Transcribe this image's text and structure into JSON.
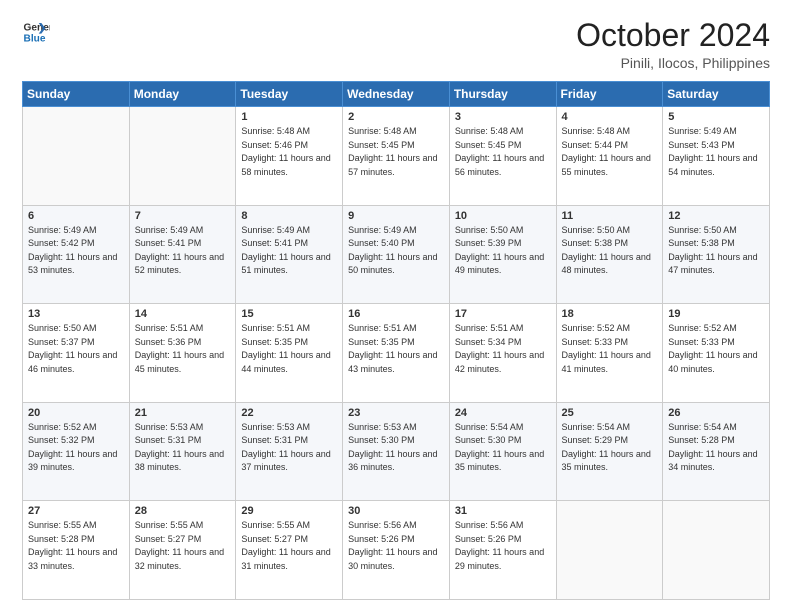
{
  "header": {
    "logo_line1": "General",
    "logo_line2": "Blue",
    "month": "October 2024",
    "location": "Pinili, Ilocos, Philippines"
  },
  "weekdays": [
    "Sunday",
    "Monday",
    "Tuesday",
    "Wednesday",
    "Thursday",
    "Friday",
    "Saturday"
  ],
  "weeks": [
    [
      {
        "day": "",
        "sunrise": "",
        "sunset": "",
        "daylight": ""
      },
      {
        "day": "",
        "sunrise": "",
        "sunset": "",
        "daylight": ""
      },
      {
        "day": "1",
        "sunrise": "Sunrise: 5:48 AM",
        "sunset": "Sunset: 5:46 PM",
        "daylight": "Daylight: 11 hours and 58 minutes."
      },
      {
        "day": "2",
        "sunrise": "Sunrise: 5:48 AM",
        "sunset": "Sunset: 5:45 PM",
        "daylight": "Daylight: 11 hours and 57 minutes."
      },
      {
        "day": "3",
        "sunrise": "Sunrise: 5:48 AM",
        "sunset": "Sunset: 5:45 PM",
        "daylight": "Daylight: 11 hours and 56 minutes."
      },
      {
        "day": "4",
        "sunrise": "Sunrise: 5:48 AM",
        "sunset": "Sunset: 5:44 PM",
        "daylight": "Daylight: 11 hours and 55 minutes."
      },
      {
        "day": "5",
        "sunrise": "Sunrise: 5:49 AM",
        "sunset": "Sunset: 5:43 PM",
        "daylight": "Daylight: 11 hours and 54 minutes."
      }
    ],
    [
      {
        "day": "6",
        "sunrise": "Sunrise: 5:49 AM",
        "sunset": "Sunset: 5:42 PM",
        "daylight": "Daylight: 11 hours and 53 minutes."
      },
      {
        "day": "7",
        "sunrise": "Sunrise: 5:49 AM",
        "sunset": "Sunset: 5:41 PM",
        "daylight": "Daylight: 11 hours and 52 minutes."
      },
      {
        "day": "8",
        "sunrise": "Sunrise: 5:49 AM",
        "sunset": "Sunset: 5:41 PM",
        "daylight": "Daylight: 11 hours and 51 minutes."
      },
      {
        "day": "9",
        "sunrise": "Sunrise: 5:49 AM",
        "sunset": "Sunset: 5:40 PM",
        "daylight": "Daylight: 11 hours and 50 minutes."
      },
      {
        "day": "10",
        "sunrise": "Sunrise: 5:50 AM",
        "sunset": "Sunset: 5:39 PM",
        "daylight": "Daylight: 11 hours and 49 minutes."
      },
      {
        "day": "11",
        "sunrise": "Sunrise: 5:50 AM",
        "sunset": "Sunset: 5:38 PM",
        "daylight": "Daylight: 11 hours and 48 minutes."
      },
      {
        "day": "12",
        "sunrise": "Sunrise: 5:50 AM",
        "sunset": "Sunset: 5:38 PM",
        "daylight": "Daylight: 11 hours and 47 minutes."
      }
    ],
    [
      {
        "day": "13",
        "sunrise": "Sunrise: 5:50 AM",
        "sunset": "Sunset: 5:37 PM",
        "daylight": "Daylight: 11 hours and 46 minutes."
      },
      {
        "day": "14",
        "sunrise": "Sunrise: 5:51 AM",
        "sunset": "Sunset: 5:36 PM",
        "daylight": "Daylight: 11 hours and 45 minutes."
      },
      {
        "day": "15",
        "sunrise": "Sunrise: 5:51 AM",
        "sunset": "Sunset: 5:35 PM",
        "daylight": "Daylight: 11 hours and 44 minutes."
      },
      {
        "day": "16",
        "sunrise": "Sunrise: 5:51 AM",
        "sunset": "Sunset: 5:35 PM",
        "daylight": "Daylight: 11 hours and 43 minutes."
      },
      {
        "day": "17",
        "sunrise": "Sunrise: 5:51 AM",
        "sunset": "Sunset: 5:34 PM",
        "daylight": "Daylight: 11 hours and 42 minutes."
      },
      {
        "day": "18",
        "sunrise": "Sunrise: 5:52 AM",
        "sunset": "Sunset: 5:33 PM",
        "daylight": "Daylight: 11 hours and 41 minutes."
      },
      {
        "day": "19",
        "sunrise": "Sunrise: 5:52 AM",
        "sunset": "Sunset: 5:33 PM",
        "daylight": "Daylight: 11 hours and 40 minutes."
      }
    ],
    [
      {
        "day": "20",
        "sunrise": "Sunrise: 5:52 AM",
        "sunset": "Sunset: 5:32 PM",
        "daylight": "Daylight: 11 hours and 39 minutes."
      },
      {
        "day": "21",
        "sunrise": "Sunrise: 5:53 AM",
        "sunset": "Sunset: 5:31 PM",
        "daylight": "Daylight: 11 hours and 38 minutes."
      },
      {
        "day": "22",
        "sunrise": "Sunrise: 5:53 AM",
        "sunset": "Sunset: 5:31 PM",
        "daylight": "Daylight: 11 hours and 37 minutes."
      },
      {
        "day": "23",
        "sunrise": "Sunrise: 5:53 AM",
        "sunset": "Sunset: 5:30 PM",
        "daylight": "Daylight: 11 hours and 36 minutes."
      },
      {
        "day": "24",
        "sunrise": "Sunrise: 5:54 AM",
        "sunset": "Sunset: 5:30 PM",
        "daylight": "Daylight: 11 hours and 35 minutes."
      },
      {
        "day": "25",
        "sunrise": "Sunrise: 5:54 AM",
        "sunset": "Sunset: 5:29 PM",
        "daylight": "Daylight: 11 hours and 35 minutes."
      },
      {
        "day": "26",
        "sunrise": "Sunrise: 5:54 AM",
        "sunset": "Sunset: 5:28 PM",
        "daylight": "Daylight: 11 hours and 34 minutes."
      }
    ],
    [
      {
        "day": "27",
        "sunrise": "Sunrise: 5:55 AM",
        "sunset": "Sunset: 5:28 PM",
        "daylight": "Daylight: 11 hours and 33 minutes."
      },
      {
        "day": "28",
        "sunrise": "Sunrise: 5:55 AM",
        "sunset": "Sunset: 5:27 PM",
        "daylight": "Daylight: 11 hours and 32 minutes."
      },
      {
        "day": "29",
        "sunrise": "Sunrise: 5:55 AM",
        "sunset": "Sunset: 5:27 PM",
        "daylight": "Daylight: 11 hours and 31 minutes."
      },
      {
        "day": "30",
        "sunrise": "Sunrise: 5:56 AM",
        "sunset": "Sunset: 5:26 PM",
        "daylight": "Daylight: 11 hours and 30 minutes."
      },
      {
        "day": "31",
        "sunrise": "Sunrise: 5:56 AM",
        "sunset": "Sunset: 5:26 PM",
        "daylight": "Daylight: 11 hours and 29 minutes."
      },
      {
        "day": "",
        "sunrise": "",
        "sunset": "",
        "daylight": ""
      },
      {
        "day": "",
        "sunrise": "",
        "sunset": "",
        "daylight": ""
      }
    ]
  ]
}
